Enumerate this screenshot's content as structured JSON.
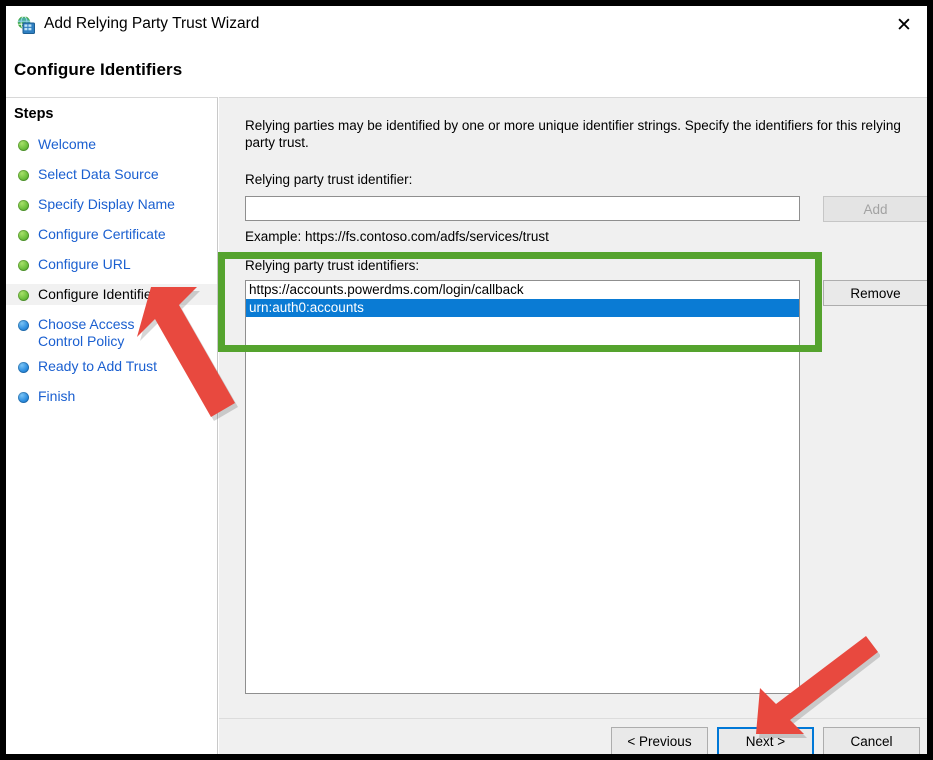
{
  "window": {
    "title": "Add Relying Party Trust Wizard",
    "app_icon": "adfs-server-globe-icon",
    "close_label": "✕",
    "heading": "Configure Identifiers"
  },
  "sidebar": {
    "title": "Steps",
    "items": [
      {
        "label": "Welcome",
        "state": "done",
        "bullet": "green"
      },
      {
        "label": "Select Data Source",
        "state": "done",
        "bullet": "green"
      },
      {
        "label": "Specify Display Name",
        "state": "done",
        "bullet": "green"
      },
      {
        "label": "Configure Certificate",
        "state": "done",
        "bullet": "green"
      },
      {
        "label": "Configure URL",
        "state": "done",
        "bullet": "green"
      },
      {
        "label": "Configure Identifiers",
        "state": "current",
        "bullet": "green"
      },
      {
        "label": "Choose Access Control Policy",
        "state": "pending",
        "bullet": "blue"
      },
      {
        "label": "Ready to Add Trust",
        "state": "pending",
        "bullet": "blue"
      },
      {
        "label": "Finish",
        "state": "pending",
        "bullet": "blue"
      }
    ]
  },
  "main": {
    "intro": "Relying parties may be identified by one or more unique identifier strings. Specify the identifiers for this relying party trust.",
    "identifier_label": "Relying party trust identifier:",
    "identifier_value": "",
    "identifier_placeholder": "",
    "add_label": "Add",
    "add_disabled": true,
    "example": "Example: https://fs.contoso.com/adfs/services/trust",
    "identifiers_label": "Relying party trust identifiers:",
    "identifiers": [
      {
        "value": "https://accounts.powerdms.com/login/callback",
        "selected": false
      },
      {
        "value": "urn:auth0:accounts",
        "selected": true
      }
    ],
    "remove_label": "Remove"
  },
  "footer": {
    "previous_label": "< Previous",
    "next_label": "Next >",
    "cancel_label": "Cancel",
    "focused_button": "Next >"
  },
  "annotations": {
    "highlight_color": "#55a32e",
    "arrow_color": "#e8493f",
    "arrow1_target": "Configure Identifiers",
    "arrow2_target": "Next >"
  }
}
